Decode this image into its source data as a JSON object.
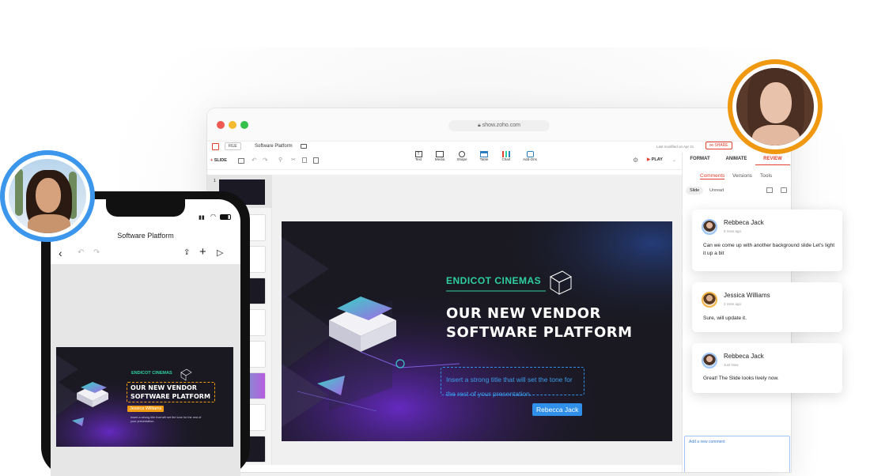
{
  "window": {
    "url": "show.zoho.com",
    "menu": {
      "file": "FILE",
      "doc_title": "Software Platform",
      "last_modified": "Last modified on Apr 21",
      "share": "SHARE"
    },
    "toolbar": {
      "slide": "SLIDE",
      "play": "PLAY",
      "tools": [
        "Text",
        "Media",
        "Shape",
        "Table",
        "Chart",
        "Add-Ons"
      ]
    },
    "panel_tabs": {
      "format": "FORMAT",
      "animate": "ANIMATE",
      "review": "REVIEW"
    },
    "review": {
      "subtabs": [
        "Comments",
        "Versions",
        "Tools"
      ],
      "filters": [
        "Slide",
        "Unread"
      ],
      "add_comment_placeholder": "Add a new comment"
    },
    "slide_number": "1"
  },
  "slide": {
    "brand": "ENDICOT CINEMAS",
    "title_line1": "OUR NEW VENDOR",
    "title_line2": "SOFTWARE PLATFORM",
    "placeholder": "Insert a strong title that will set the tone for the rest of your presentation.",
    "cursor_label": "Rebecca Jack"
  },
  "comments": [
    {
      "name": "Rebbeca Jack",
      "time": "5 mins ago",
      "text": "Can we come up with another background slide Let's light it up a bit"
    },
    {
      "name": "Jessica Williams",
      "time": "2 mins ago",
      "text": "Sure, will update it."
    },
    {
      "name": "Rebbeca Jack",
      "time": "Just Now",
      "text": "Great! The Slide looks lively now."
    }
  ],
  "phone": {
    "title": "Software Platform",
    "slide": {
      "brand": "ENDICOT CINEMAS",
      "title_line1": "OUR NEW VENDOR",
      "title_line2": "SOFTWARE PLATFORM",
      "cursor_label": "Jessica Williams",
      "placeholder": "Insert a strong title that will set the tone for the rest of your presentation."
    }
  },
  "colors": {
    "accent_red": "#e2412f",
    "brand_green": "#2ecfa1",
    "cursor_blue": "#2f8fe9",
    "phone_cursor_orange": "#f29a12",
    "avatar_blue_ring": "#3b96ec",
    "avatar_orange_ring": "#f0980f"
  }
}
